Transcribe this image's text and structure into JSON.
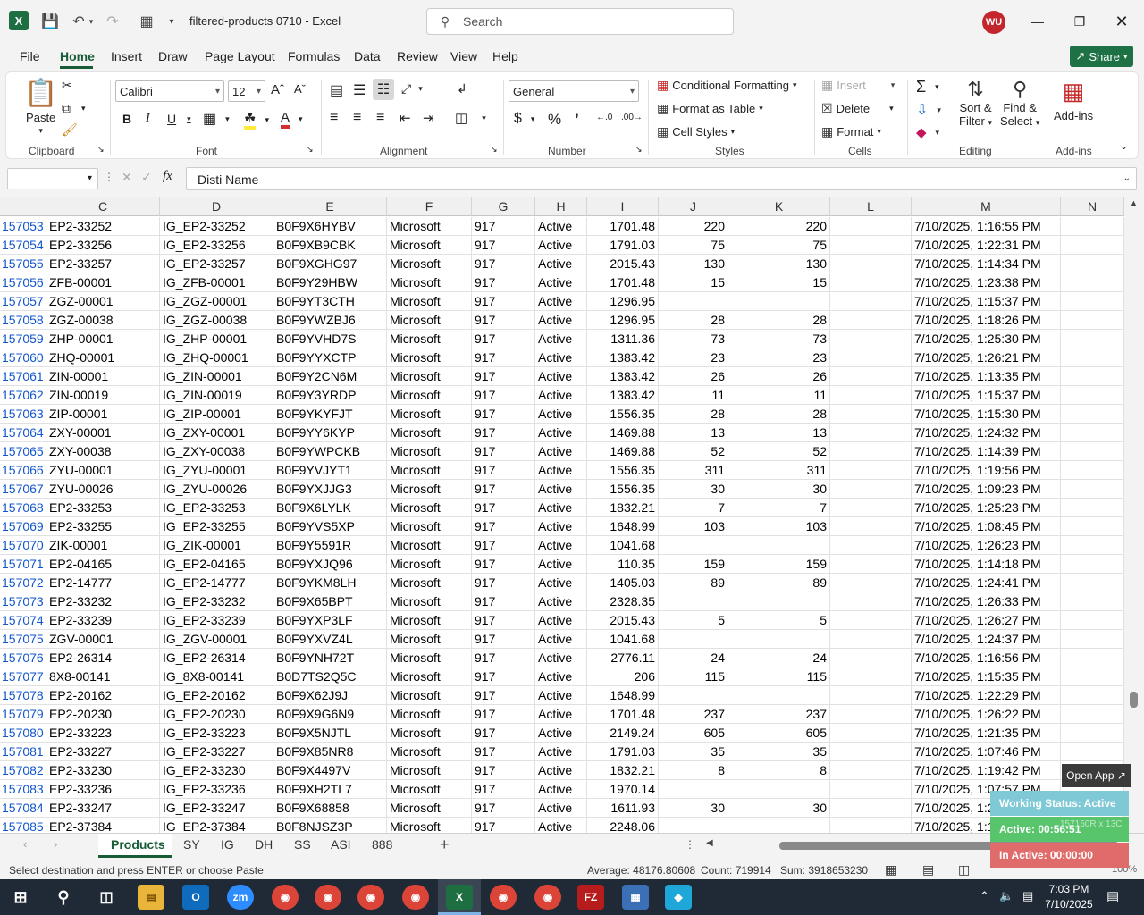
{
  "window": {
    "doc_title": "filtered-products 0710  -  Excel",
    "search_placeholder": "Search",
    "avatar": "WU"
  },
  "menu": [
    "File",
    "Home",
    "Insert",
    "Draw",
    "Page Layout",
    "Formulas",
    "Data",
    "Review",
    "View",
    "Help"
  ],
  "share_label": "Share",
  "ribbon": {
    "clipboard": {
      "paste": "Paste",
      "label": "Clipboard"
    },
    "font": {
      "name": "Calibri",
      "size": "12",
      "label": "Font"
    },
    "alignment": {
      "label": "Alignment"
    },
    "number": {
      "format": "General",
      "label": "Number"
    },
    "styles": {
      "conditional": "Conditional Formatting",
      "format_table": "Format as Table",
      "cell_styles": "Cell Styles",
      "label": "Styles"
    },
    "cells": {
      "insert": "Insert",
      "delete": "Delete",
      "format": "Format",
      "label": "Cells"
    },
    "editing": {
      "sort": "Sort &",
      "sort2": "Filter",
      "find": "Find &",
      "find2": "Select",
      "label": "Editing"
    },
    "addins": {
      "btn": "Add-ins",
      "label": "Add-ins"
    }
  },
  "formula": {
    "fx": "fx",
    "content": "Disti Name"
  },
  "columns": [
    "C",
    "D",
    "E",
    "F",
    "G",
    "H",
    "I",
    "J",
    "K",
    "L",
    "M",
    "N"
  ],
  "rows": [
    [
      "157053",
      "EP2-33252",
      "IG_EP2-33252",
      "B0F9X6HYBV",
      "Microsoft",
      "917",
      "Active",
      "1701.48",
      "220",
      "220",
      "",
      "7/10/2025, 1:16:55 PM"
    ],
    [
      "157054",
      "EP2-33256",
      "IG_EP2-33256",
      "B0F9XB9CBK",
      "Microsoft",
      "917",
      "Active",
      "1791.03",
      "75",
      "75",
      "",
      "7/10/2025, 1:22:31 PM"
    ],
    [
      "157055",
      "EP2-33257",
      "IG_EP2-33257",
      "B0F9XGHG97",
      "Microsoft",
      "917",
      "Active",
      "2015.43",
      "130",
      "130",
      "",
      "7/10/2025, 1:14:34 PM"
    ],
    [
      "157056",
      "ZFB-00001",
      "IG_ZFB-00001",
      "B0F9Y29HBW",
      "Microsoft",
      "917",
      "Active",
      "1701.48",
      "15",
      "15",
      "",
      "7/10/2025, 1:23:38 PM"
    ],
    [
      "157057",
      "ZGZ-00001",
      "IG_ZGZ-00001",
      "B0F9YT3CTH",
      "Microsoft",
      "917",
      "Active",
      "1296.95",
      "",
      "",
      "",
      "7/10/2025, 1:15:37 PM"
    ],
    [
      "157058",
      "ZGZ-00038",
      "IG_ZGZ-00038",
      "B0F9YWZBJ6",
      "Microsoft",
      "917",
      "Active",
      "1296.95",
      "28",
      "28",
      "",
      "7/10/2025, 1:18:26 PM"
    ],
    [
      "157059",
      "ZHP-00001",
      "IG_ZHP-00001",
      "B0F9YVHD7S",
      "Microsoft",
      "917",
      "Active",
      "1311.36",
      "73",
      "73",
      "",
      "7/10/2025, 1:25:30 PM"
    ],
    [
      "157060",
      "ZHQ-00001",
      "IG_ZHQ-00001",
      "B0F9YYXCTP",
      "Microsoft",
      "917",
      "Active",
      "1383.42",
      "23",
      "23",
      "",
      "7/10/2025, 1:26:21 PM"
    ],
    [
      "157061",
      "ZIN-00001",
      "IG_ZIN-00001",
      "B0F9Y2CN6M",
      "Microsoft",
      "917",
      "Active",
      "1383.42",
      "26",
      "26",
      "",
      "7/10/2025, 1:13:35 PM"
    ],
    [
      "157062",
      "ZIN-00019",
      "IG_ZIN-00019",
      "B0F9Y3YRDP",
      "Microsoft",
      "917",
      "Active",
      "1383.42",
      "11",
      "11",
      "",
      "7/10/2025, 1:15:37 PM"
    ],
    [
      "157063",
      "ZIP-00001",
      "IG_ZIP-00001",
      "B0F9YKYFJT",
      "Microsoft",
      "917",
      "Active",
      "1556.35",
      "28",
      "28",
      "",
      "7/10/2025, 1:15:30 PM"
    ],
    [
      "157064",
      "ZXY-00001",
      "IG_ZXY-00001",
      "B0F9YY6KYP",
      "Microsoft",
      "917",
      "Active",
      "1469.88",
      "13",
      "13",
      "",
      "7/10/2025, 1:24:32 PM"
    ],
    [
      "157065",
      "ZXY-00038",
      "IG_ZXY-00038",
      "B0F9YWPCKB",
      "Microsoft",
      "917",
      "Active",
      "1469.88",
      "52",
      "52",
      "",
      "7/10/2025, 1:14:39 PM"
    ],
    [
      "157066",
      "ZYU-00001",
      "IG_ZYU-00001",
      "B0F9YVJYT1",
      "Microsoft",
      "917",
      "Active",
      "1556.35",
      "311",
      "311",
      "",
      "7/10/2025, 1:19:56 PM"
    ],
    [
      "157067",
      "ZYU-00026",
      "IG_ZYU-00026",
      "B0F9YXJJG3",
      "Microsoft",
      "917",
      "Active",
      "1556.35",
      "30",
      "30",
      "",
      "7/10/2025, 1:09:23 PM"
    ],
    [
      "157068",
      "EP2-33253",
      "IG_EP2-33253",
      "B0F9X6LYLK",
      "Microsoft",
      "917",
      "Active",
      "1832.21",
      "7",
      "7",
      "",
      "7/10/2025, 1:25:23 PM"
    ],
    [
      "157069",
      "EP2-33255",
      "IG_EP2-33255",
      "B0F9YVS5XP",
      "Microsoft",
      "917",
      "Active",
      "1648.99",
      "103",
      "103",
      "",
      "7/10/2025, 1:08:45 PM"
    ],
    [
      "157070",
      "ZIK-00001",
      "IG_ZIK-00001",
      "B0F9Y5591R",
      "Microsoft",
      "917",
      "Active",
      "1041.68",
      "",
      "",
      "",
      "7/10/2025, 1:26:23 PM"
    ],
    [
      "157071",
      "EP2-04165",
      "IG_EP2-04165",
      "B0F9YXJQ96",
      "Microsoft",
      "917",
      "Active",
      "110.35",
      "159",
      "159",
      "",
      "7/10/2025, 1:14:18 PM"
    ],
    [
      "157072",
      "EP2-14777",
      "IG_EP2-14777",
      "B0F9YKM8LH",
      "Microsoft",
      "917",
      "Active",
      "1405.03",
      "89",
      "89",
      "",
      "7/10/2025, 1:24:41 PM"
    ],
    [
      "157073",
      "EP2-33232",
      "IG_EP2-33232",
      "B0F9X65BPT",
      "Microsoft",
      "917",
      "Active",
      "2328.35",
      "",
      "",
      "",
      "7/10/2025, 1:26:33 PM"
    ],
    [
      "157074",
      "EP2-33239",
      "IG_EP2-33239",
      "B0F9YXP3LF",
      "Microsoft",
      "917",
      "Active",
      "2015.43",
      "5",
      "5",
      "",
      "7/10/2025, 1:26:27 PM"
    ],
    [
      "157075",
      "ZGV-00001",
      "IG_ZGV-00001",
      "B0F9YXVZ4L",
      "Microsoft",
      "917",
      "Active",
      "1041.68",
      "",
      "",
      "",
      "7/10/2025, 1:24:37 PM"
    ],
    [
      "157076",
      "EP2-26314",
      "IG_EP2-26314",
      "B0F9YNH72T",
      "Microsoft",
      "917",
      "Active",
      "2776.11",
      "24",
      "24",
      "",
      "7/10/2025, 1:16:56 PM"
    ],
    [
      "157077",
      "8X8-00141",
      "IG_8X8-00141",
      "B0D7TS2Q5C",
      "Microsoft",
      "917",
      "Active",
      "206",
      "115",
      "115",
      "",
      "7/10/2025, 1:15:35 PM"
    ],
    [
      "157078",
      "EP2-20162",
      "IG_EP2-20162",
      "B0F9X62J9J",
      "Microsoft",
      "917",
      "Active",
      "1648.99",
      "",
      "",
      "",
      "7/10/2025, 1:22:29 PM"
    ],
    [
      "157079",
      "EP2-20230",
      "IG_EP2-20230",
      "B0F9X9G6N9",
      "Microsoft",
      "917",
      "Active",
      "1701.48",
      "237",
      "237",
      "",
      "7/10/2025, 1:26:22 PM"
    ],
    [
      "157080",
      "EP2-33223",
      "IG_EP2-33223",
      "B0F9X5NJTL",
      "Microsoft",
      "917",
      "Active",
      "2149.24",
      "605",
      "605",
      "",
      "7/10/2025, 1:21:35 PM"
    ],
    [
      "157081",
      "EP2-33227",
      "IG_EP2-33227",
      "B0F9X85NR8",
      "Microsoft",
      "917",
      "Active",
      "1791.03",
      "35",
      "35",
      "",
      "7/10/2025, 1:07:46 PM"
    ],
    [
      "157082",
      "EP2-33230",
      "IG_EP2-33230",
      "B0F9X4497V",
      "Microsoft",
      "917",
      "Active",
      "1832.21",
      "8",
      "8",
      "",
      "7/10/2025, 1:19:42 PM"
    ],
    [
      "157083",
      "EP2-33236",
      "IG_EP2-33236",
      "B0F9XH2TL7",
      "Microsoft",
      "917",
      "Active",
      "1970.14",
      "",
      "",
      "",
      "7/10/2025, 1:07:57 PM"
    ],
    [
      "157084",
      "EP2-33247",
      "IG_EP2-33247",
      "B0F9X68858",
      "Microsoft",
      "917",
      "Active",
      "1611.93",
      "30",
      "30",
      "",
      "7/10/2025, 1:22:13 PM"
    ],
    [
      "157085",
      "EP2-37384",
      "IG_EP2-37384",
      "B0F8NJSZ3P",
      "Microsoft",
      "917",
      "Active",
      "2248.06",
      "",
      "",
      "",
      "7/10/2025, 1:10:53 PM"
    ]
  ],
  "sheets": [
    "Products",
    "SY",
    "IG",
    "DH",
    "SS",
    "ASI",
    "888"
  ],
  "status": {
    "message": "Select destination and press ENTER or choose Paste",
    "average": "Average: 48176.80608",
    "count": "Count: 719914",
    "sum": "Sum: 3918653230",
    "zoom": "100%"
  },
  "overlay": {
    "open_app": "Open App ↗",
    "working": "Working Status: Active",
    "active": "Active: 00:56:51",
    "inactive": "In Active: 00:00:00",
    "faint": "157150R x 13C"
  },
  "taskbar": {
    "time": "7:03 PM",
    "date": "7/10/2025"
  },
  "colors": {
    "excel_green": "#185c37",
    "share_green": "#1e7145",
    "avatar_red": "#c4262e",
    "rownum_blue": "#1155cc"
  }
}
